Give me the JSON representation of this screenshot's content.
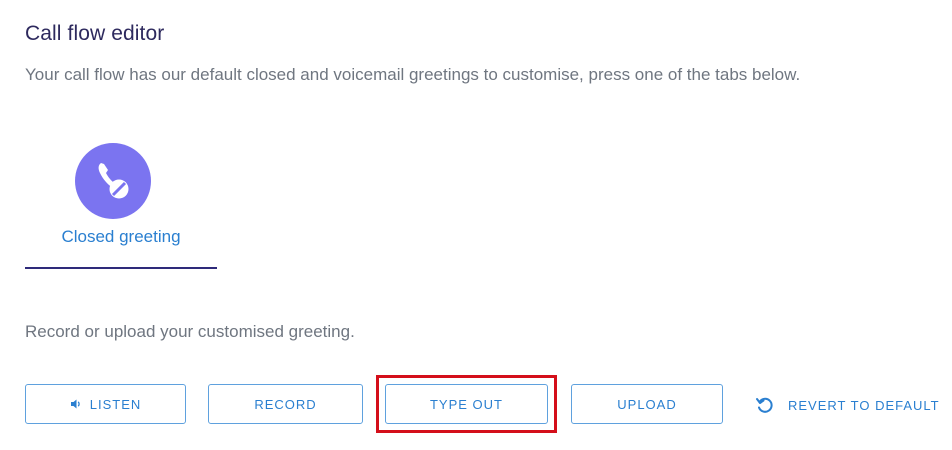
{
  "header": {
    "title": "Call flow editor",
    "subtitle": "Your call flow has our default closed and voicemail greetings to customise, press one of the tabs below."
  },
  "tabs": [
    {
      "label": "Closed greeting",
      "icon": "phone-closed-icon",
      "selected": true
    }
  ],
  "greeting": {
    "helper_text": "Record or upload your customised greeting."
  },
  "actions": {
    "listen_label": "LISTEN",
    "listen_icon": "speaker-icon",
    "record_label": "RECORD",
    "type_out_label": "TYPE OUT",
    "upload_label": "UPLOAD",
    "revert_label": "REVERT TO DEFAULT",
    "revert_icon": "revert-icon"
  },
  "colors": {
    "accent": "#2a7fd0",
    "tab_icon_bg": "#7b74f0",
    "title": "#2e2a5e",
    "highlight": "#d40f1a"
  }
}
